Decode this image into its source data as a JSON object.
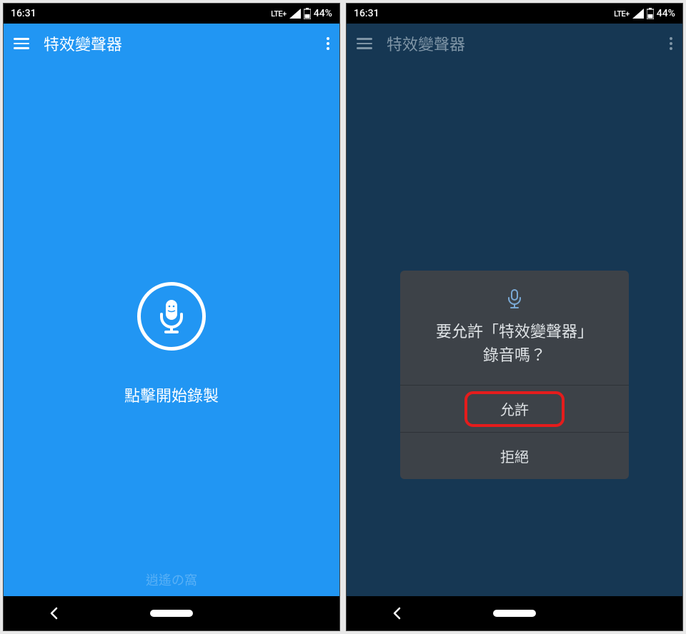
{
  "status": {
    "time": "16:31",
    "network": "LTE+",
    "battery": "44%"
  },
  "app": {
    "title": "特效變聲器",
    "record_hint": "點擊開始錄製",
    "watermark": "逍遙の窩"
  },
  "dialog": {
    "message_line1": "要允許「特效變聲器」",
    "message_line2": "錄音嗎？",
    "allow": "允許",
    "deny": "拒絕"
  }
}
